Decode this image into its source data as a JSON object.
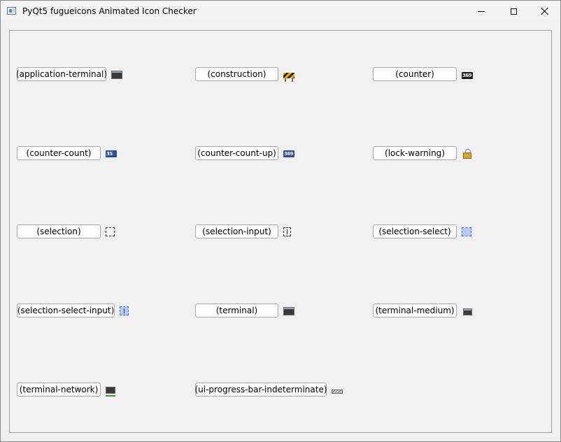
{
  "window": {
    "title": "PyQt5 fugueicons Animated Icon Checker",
    "controls": {
      "minimize": "minimize",
      "maximize": "maximize",
      "close": "close"
    }
  },
  "icons": [
    {
      "label": "(application-terminal)",
      "icon": "application-terminal-icon"
    },
    {
      "label": "(construction)",
      "icon": "construction-icon"
    },
    {
      "label": "(counter)",
      "icon": "counter-icon",
      "glyph": "369"
    },
    {
      "label": "(counter-count)",
      "icon": "counter-count-icon",
      "glyph": "35"
    },
    {
      "label": "(counter-count-up)",
      "icon": "counter-count-up-icon",
      "glyph": "369"
    },
    {
      "label": "(lock-warning)",
      "icon": "lock-warning-icon"
    },
    {
      "label": "(selection)",
      "icon": "selection-icon"
    },
    {
      "label": "(selection-input)",
      "icon": "selection-input-icon"
    },
    {
      "label": "(selection-select)",
      "icon": "selection-select-icon"
    },
    {
      "label": "(selection-select-input)",
      "icon": "selection-select-input-icon"
    },
    {
      "label": "(terminal)",
      "icon": "terminal-icon"
    },
    {
      "label": "(terminal-medium)",
      "icon": "terminal-medium-icon"
    },
    {
      "label": "(terminal-network)",
      "icon": "terminal-network-icon"
    },
    {
      "label": "(ui-progress-bar-indeterminate)",
      "icon": "ui-progress-bar-indeterminate-icon"
    }
  ],
  "colors": {
    "window_bg": "#f0f0f0",
    "titlebar_bg": "#f3f3f3",
    "button_border": "#a8a8a8"
  }
}
